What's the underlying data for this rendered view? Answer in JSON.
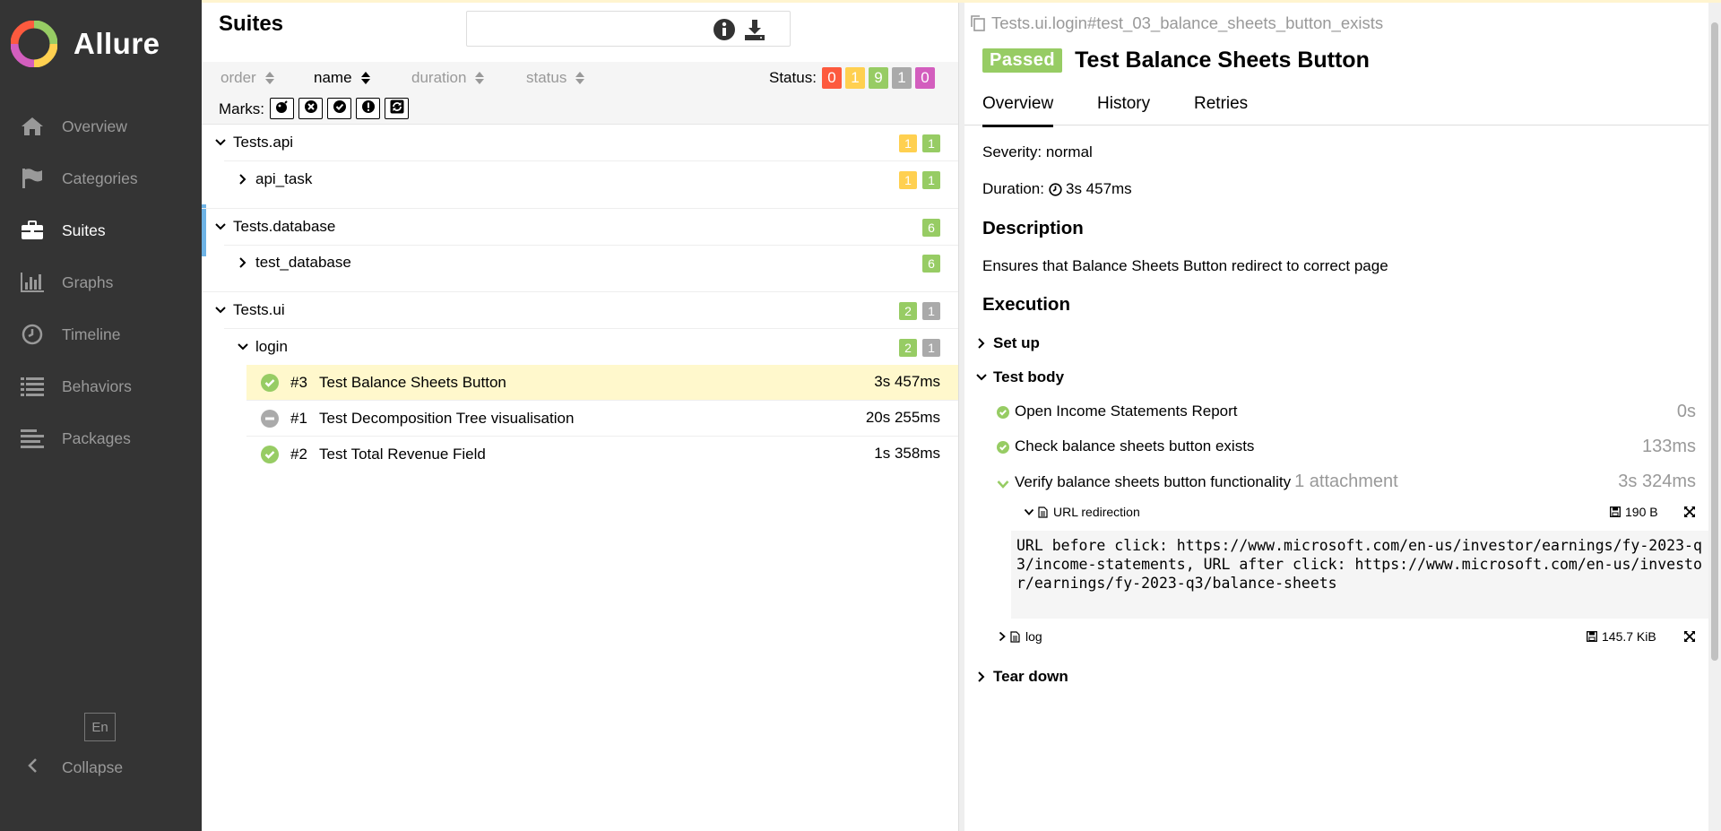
{
  "sidebar": {
    "brand": "Allure",
    "items": [
      {
        "label": "Overview",
        "icon": "home-icon"
      },
      {
        "label": "Categories",
        "icon": "flag-icon"
      },
      {
        "label": "Suites",
        "icon": "briefcase-icon",
        "active": true
      },
      {
        "label": "Graphs",
        "icon": "bar-chart-icon"
      },
      {
        "label": "Timeline",
        "icon": "clock-icon"
      },
      {
        "label": "Behaviors",
        "icon": "list-icon"
      },
      {
        "label": "Packages",
        "icon": "align-left-icon"
      }
    ],
    "language": "En",
    "collapse_label": "Collapse"
  },
  "suites_panel": {
    "title": "Suites",
    "search_placeholder": "",
    "sort": {
      "order": "order",
      "name": "name",
      "duration": "duration",
      "status": "status"
    },
    "status_label": "Status:",
    "status_counts": {
      "failed": "0",
      "broken": "1",
      "passed": "9",
      "skipped": "1",
      "unknown": "0"
    },
    "marks_label": "Marks:",
    "groups": [
      {
        "name": "Tests.api",
        "counts": [
          "1",
          "1"
        ],
        "children": [
          {
            "name": "api_task",
            "counts": [
              "1",
              "1"
            ]
          }
        ]
      },
      {
        "name": "Tests.database",
        "counts": [
          "6"
        ],
        "children": [
          {
            "name": "test_database",
            "counts": [
              "6"
            ]
          }
        ]
      },
      {
        "name": "Tests.ui",
        "counts": [
          "2",
          "1"
        ],
        "children": [
          {
            "name": "login",
            "counts": [
              "2",
              "1"
            ]
          }
        ]
      }
    ],
    "tests": [
      {
        "num": "#3",
        "name": "Test Balance Sheets Button",
        "duration": "3s 457ms",
        "status": "passed"
      },
      {
        "num": "#1",
        "name": "Test Decomposition Tree visualisation",
        "duration": "20s 255ms",
        "status": "skipped"
      },
      {
        "num": "#2",
        "name": "Test Total Revenue Field",
        "duration": "1s 358ms",
        "status": "passed"
      }
    ]
  },
  "details": {
    "path": "Tests.ui.login#test_03_balance_sheets_button_exists",
    "status_badge": "Passed",
    "title": "Test Balance Sheets Button",
    "tabs": [
      "Overview",
      "History",
      "Retries"
    ],
    "severity": "Severity: normal",
    "duration_label": "Duration:",
    "duration_value": "3s 457ms",
    "description_heading": "Description",
    "description": "Ensures that Balance Sheets Button redirect to correct page",
    "execution_heading": "Execution",
    "setup_label": "Set up",
    "test_body_label": "Test body",
    "steps": [
      {
        "name": "Open Income Statements Report",
        "duration": "0s"
      },
      {
        "name": "Check balance sheets button exists",
        "duration": "133ms"
      },
      {
        "name": "Verify balance sheets button functionality",
        "attachments": "1 attachment",
        "duration": "3s 324ms"
      }
    ],
    "attachment": {
      "name": "URL redirection",
      "size": "190 B"
    },
    "attachment_content": "URL before click: https://www.microsoft.com/en-us/investor/earnings/fy-2023-q3/income-statements, URL after click: https://www.microsoft.com/en-us/investor/earnings/fy-2023-q3/balance-sheets",
    "log": {
      "name": "log",
      "size": "145.7 KiB"
    },
    "teardown_label": "Tear down"
  },
  "colors": {
    "failed": "#fd5a3e",
    "broken": "#ffd050",
    "passed": "#97cc64",
    "skipped": "#aaaaaa",
    "unknown": "#d35ebe",
    "sidebar_bg": "#343434",
    "accent": "#6eb3e5"
  }
}
